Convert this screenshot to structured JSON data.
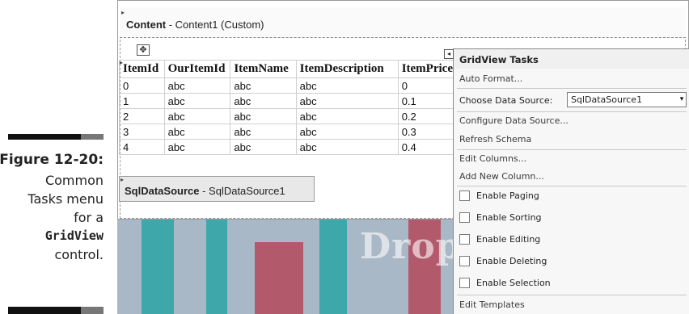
{
  "caption": {
    "figure": "Figure 12-20:",
    "line1": "Common",
    "line2": "Tasks menu",
    "line3": "for a",
    "code": "GridView",
    "line5": "control."
  },
  "content": {
    "label_bold": "Content",
    "label_rest": " - Content1 (Custom)"
  },
  "grid": {
    "columns": [
      "ItemId",
      "OurItemId",
      "ItemName",
      "ItemDescription",
      "ItemPrice"
    ],
    "rows": [
      [
        "0",
        "abc",
        "abc",
        "abc",
        "0"
      ],
      [
        "1",
        "abc",
        "abc",
        "abc",
        "0.1"
      ],
      [
        "2",
        "abc",
        "abc",
        "abc",
        "0.2"
      ],
      [
        "3",
        "abc",
        "abc",
        "abc",
        "0.3"
      ],
      [
        "4",
        "abc",
        "abc",
        "abc",
        "0.4"
      ]
    ]
  },
  "datasource": {
    "label_bold": "SqlDataSource",
    "label_rest": " - SqlDataSource1"
  },
  "tasks": {
    "title": "GridView Tasks",
    "auto_format": "Auto Format...",
    "choose_ds_label": "Choose Data Source:",
    "choose_ds_value": "SqlDataSource1",
    "configure_ds": "Configure Data Source...",
    "refresh_schema": "Refresh Schema",
    "edit_columns": "Edit Columns...",
    "add_column": "Add New Column...",
    "enable_paging": "Enable Paging",
    "enable_sorting": "Enable Sorting",
    "enable_editing": "Enable Editing",
    "enable_deleting": "Enable Deleting",
    "enable_selection": "Enable Selection",
    "edit_templates": "Edit Templates"
  },
  "watermark": "DropB",
  "icons": {
    "move": "move-handle-icon",
    "collapse": "collapse-arrow-icon",
    "dropdown": "chevron-down-icon"
  }
}
